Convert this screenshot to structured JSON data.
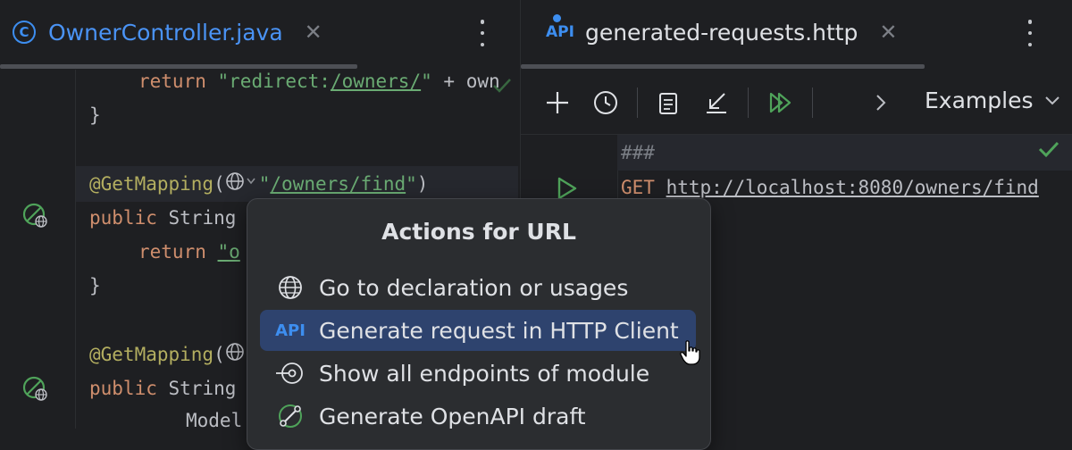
{
  "left_editor": {
    "tab": {
      "icon": "java-class-icon",
      "icon_glyph": "C",
      "title": "OwnerController.java",
      "close_glyph": "✕"
    },
    "code": {
      "line1": {
        "kw": "return ",
        "str_a": "\"redirect:",
        "url": "/owners/",
        "str_b": "\"",
        "plain": " + own"
      },
      "line2": "}",
      "line3": {
        "ann": "@GetMapping",
        "paren_open": "(",
        "str_a": "\"",
        "url": "/owners/find",
        "str_b": "\"",
        "paren_close": ")"
      },
      "line4": {
        "kw": "public ",
        "plain": "String"
      },
      "line5": {
        "kw": "return ",
        "str": "\"o"
      },
      "line6": "}",
      "line7": {
        "ann": "@GetMapping",
        "paren_open": "("
      },
      "line8": {
        "kw": "public ",
        "plain": "String"
      },
      "line9": "Model"
    }
  },
  "right_editor": {
    "tab": {
      "icon": "api-icon",
      "badge": "API",
      "title": "generated-requests.http",
      "close_glyph": "✕"
    },
    "toolbar": {
      "examples_label": "Examples"
    },
    "request": {
      "separator": "###",
      "method": "GET",
      "url": "http://localhost:8080/owners/find"
    }
  },
  "popup": {
    "title": "Actions for URL",
    "items": [
      {
        "label": "Go to declaration or usages",
        "icon": "globe-icon"
      },
      {
        "label": "Generate request in HTTP Client",
        "icon": "api-icon",
        "icon_text": "API",
        "selected": true
      },
      {
        "label": "Show all endpoints of module",
        "icon": "endpoints-icon"
      },
      {
        "label": "Generate OpenAPI draft",
        "icon": "openapi-icon"
      }
    ]
  },
  "colors": {
    "background": "#1e1f22",
    "accent_blue": "#3d8ef0",
    "keyword": "#cf8e6d",
    "string": "#6aab73",
    "annotation": "#b3ae60",
    "selection": "#2e436e",
    "run_green": "#4fa35a"
  }
}
